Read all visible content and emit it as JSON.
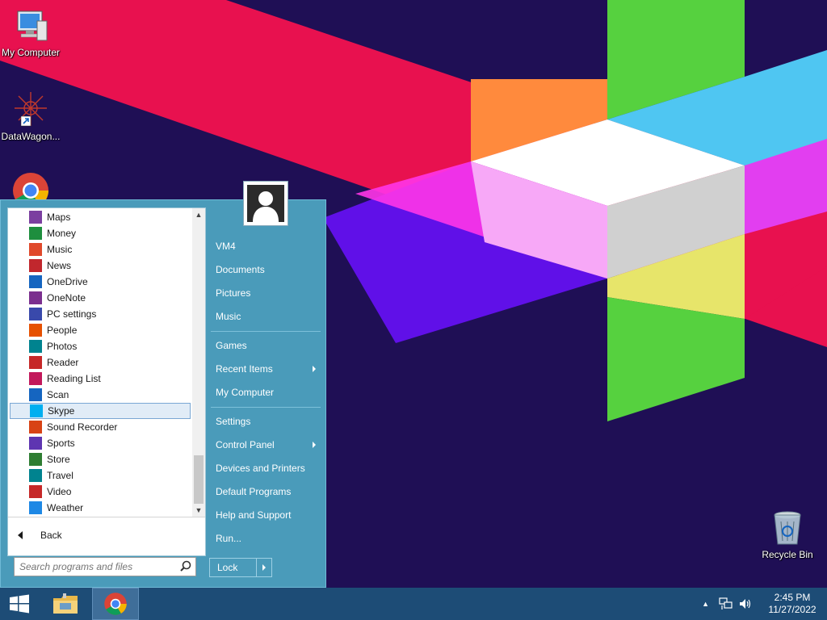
{
  "desktop": {
    "icons": [
      {
        "label": "My Computer",
        "icon": "computer-icon"
      },
      {
        "label": "DataWagon...",
        "icon": "datawagon-shortcut-icon"
      },
      {
        "label": "",
        "icon": "chrome-icon"
      },
      {
        "label": "Recycle Bin",
        "icon": "recycle-bin-icon"
      }
    ]
  },
  "start_menu": {
    "programs": [
      {
        "label": "Maps",
        "icon": "maps-icon",
        "color": "#7b3fa0"
      },
      {
        "label": "Money",
        "icon": "money-icon",
        "color": "#1e8e3e"
      },
      {
        "label": "Music",
        "icon": "music-icon",
        "color": "#e0492b"
      },
      {
        "label": "News",
        "icon": "news-icon",
        "color": "#c1272d"
      },
      {
        "label": "OneDrive",
        "icon": "onedrive-icon",
        "color": "#1565c0"
      },
      {
        "label": "OneNote",
        "icon": "onenote-icon",
        "color": "#7b2f8e"
      },
      {
        "label": "PC settings",
        "icon": "gear-icon",
        "color": "#3949ab"
      },
      {
        "label": "People",
        "icon": "people-icon",
        "color": "#e65100"
      },
      {
        "label": "Photos",
        "icon": "photos-icon",
        "color": "#00838f"
      },
      {
        "label": "Reader",
        "icon": "reader-icon",
        "color": "#c62828"
      },
      {
        "label": "Reading List",
        "icon": "reading-list-icon",
        "color": "#c2185b"
      },
      {
        "label": "Scan",
        "icon": "scan-icon",
        "color": "#1565c0"
      },
      {
        "label": "Skype",
        "icon": "skype-icon",
        "color": "#00aff0"
      },
      {
        "label": "Sound Recorder",
        "icon": "microphone-icon",
        "color": "#d84315"
      },
      {
        "label": "Sports",
        "icon": "trophy-icon",
        "color": "#5e35b1"
      },
      {
        "label": "Store",
        "icon": "store-icon",
        "color": "#2e7d32"
      },
      {
        "label": "Travel",
        "icon": "suitcase-icon",
        "color": "#00838f"
      },
      {
        "label": "Video",
        "icon": "video-icon",
        "color": "#c62828"
      },
      {
        "label": "Weather",
        "icon": "sun-icon",
        "color": "#1e88e5"
      }
    ],
    "selected_program": "Skype",
    "back_label": "Back",
    "search_placeholder": "Search programs and files",
    "user_name": "VM4",
    "links_group1": [
      "Documents",
      "Pictures",
      "Music"
    ],
    "links_group2": [
      {
        "label": "Games",
        "submenu": false
      },
      {
        "label": "Recent Items",
        "submenu": true
      },
      {
        "label": "My Computer",
        "submenu": false
      }
    ],
    "links_group3": [
      {
        "label": "Settings",
        "submenu": false
      },
      {
        "label": "Control Panel",
        "submenu": true
      },
      {
        "label": "Devices and Printers",
        "submenu": false
      },
      {
        "label": "Default Programs",
        "submenu": false
      },
      {
        "label": "Help and Support",
        "submenu": false
      },
      {
        "label": "Run...",
        "submenu": false
      }
    ],
    "lock_label": "Lock"
  },
  "taskbar": {
    "pinned": [
      "windows-start-icon",
      "file-explorer-icon",
      "chrome-icon"
    ],
    "time": "2:45 PM",
    "date": "11/27/2022"
  },
  "colors": {
    "menu_bg": "#4a9bba",
    "taskbar_bg": "#1d4c76",
    "desktop_bg": "#1f0f55"
  }
}
